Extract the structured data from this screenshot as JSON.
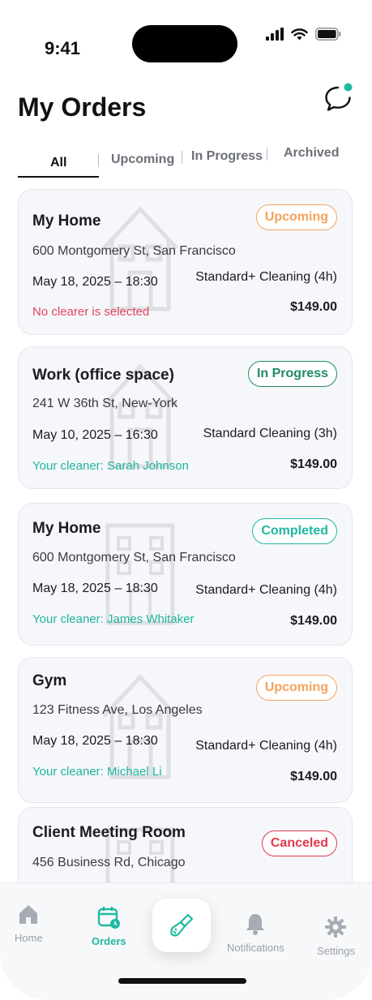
{
  "status_bar": {
    "time": "9:41"
  },
  "header": {
    "title": "My Orders"
  },
  "tabs": [
    {
      "label": "All",
      "active": true
    },
    {
      "label": "Upcoming",
      "active": false
    },
    {
      "label": "In Progress",
      "active": false
    },
    {
      "label": "Archived",
      "active": false
    }
  ],
  "orders": [
    {
      "place": "My Home",
      "status": "Upcoming",
      "address": "600 Montgomery St, San Francisco",
      "datetime": "May 18, 2025 – 18:30",
      "service": "Standard+ Cleaning (4h)",
      "cleaner": "No clearer is selected",
      "price": "$149.00"
    },
    {
      "place": "Work (office space)",
      "status": "In Progress",
      "address": "241 W 36th St, New-York",
      "datetime": "May 10, 2025 – 16:30",
      "service": "Standard Cleaning (3h)",
      "cleaner": "Your cleaner: Sarah Johnson",
      "price": "$149.00"
    },
    {
      "place": "My Home",
      "status": "Completed",
      "address": "600 Montgomery St, San Francisco",
      "datetime": "May 18, 2025 – 18:30",
      "service": "Standard+ Cleaning (4h)",
      "cleaner": "Your cleaner: James Whitaker",
      "price": "$149.00"
    },
    {
      "place": "Gym",
      "status": "Upcoming",
      "address": "123 Fitness Ave, Los Angeles",
      "datetime": "May 18, 2025 – 18:30",
      "service": "Standard+ Cleaning (4h)",
      "cleaner": "Your cleaner: Michael Li",
      "price": "$149.00"
    },
    {
      "place": "Client Meeting Room",
      "status": "Canceled",
      "address": "456 Business Rd, Chicago"
    }
  ],
  "bottom_nav": {
    "home": "Home",
    "orders": "Orders",
    "notifications": "Notifications",
    "settings": "Settings"
  },
  "colors": {
    "accent": "#1fb9a1",
    "upcoming": "#f5a35c",
    "in_progress": "#1f8a64",
    "completed": "#1fb9a1",
    "canceled": "#e0394b",
    "warning_text": "#e0465a",
    "cleaner_text": "#21b59e"
  },
  "icons": {
    "chat": "chat-bubble-icon",
    "home": "home-icon",
    "orders": "calendar-clock-icon",
    "fab": "cleaning-brush-icon",
    "notifications": "bell-icon",
    "settings": "gear-icon"
  }
}
